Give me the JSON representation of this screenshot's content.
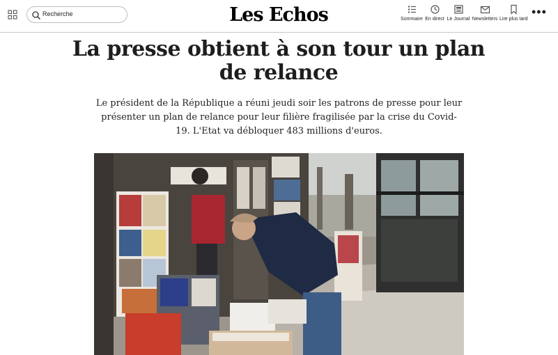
{
  "header": {
    "search_placeholder": "Recherche",
    "logo": "Les Echos",
    "nav": [
      {
        "label": "Sommaire",
        "icon": "list-icon"
      },
      {
        "label": "En direct",
        "icon": "clock-icon"
      },
      {
        "label": "Le Journal",
        "icon": "newspaper-icon"
      },
      {
        "label": "Newsletters",
        "icon": "mail-icon"
      },
      {
        "label": "Lire plus tard",
        "icon": "bookmark-icon"
      }
    ],
    "more_label": "•••"
  },
  "article": {
    "title": "La presse obtient à son tour un plan de relance",
    "lede": "Le président de la République a réuni jeudi soir les patrons de presse pour leur présenter un plan de relance pour leur filière fragilisée par la crise du Covid-19. L'Etat va débloquer 483 millions d'euros.",
    "image_alt": "Homme portant un masque achetant un journal devant un kiosque à Paris"
  },
  "colors": {
    "text": "#1e1e1e",
    "divider": "#c8c8c8",
    "background": "#ffffff"
  }
}
